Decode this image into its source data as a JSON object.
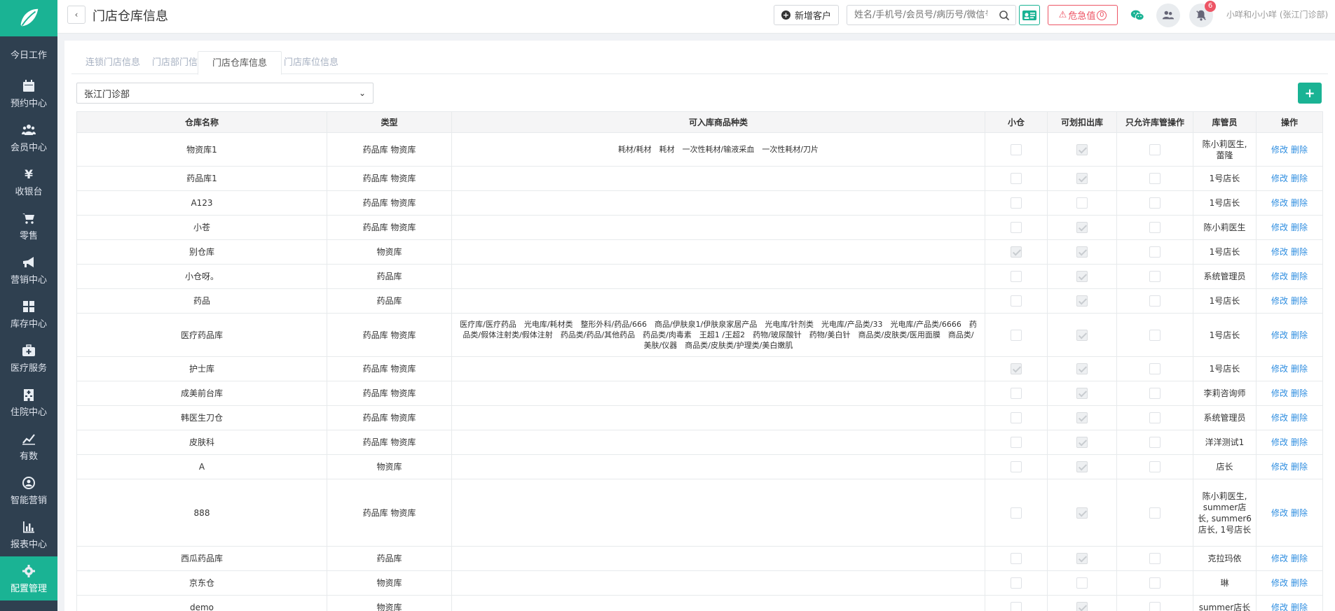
{
  "sidebar": {
    "items": [
      {
        "label": "今日工作",
        "icon": "none"
      },
      {
        "label": "预约中心",
        "icon": "calendar-icon"
      },
      {
        "label": "会员中心",
        "icon": "users-icon"
      },
      {
        "label": "收银台",
        "icon": "yen-icon"
      },
      {
        "label": "零售",
        "icon": "cart-icon"
      },
      {
        "label": "营销中心",
        "icon": "bullhorn-icon"
      },
      {
        "label": "库存中心",
        "icon": "grid-icon"
      },
      {
        "label": "医疗服务",
        "icon": "medkit-icon"
      },
      {
        "label": "住院中心",
        "icon": "hospital-icon"
      },
      {
        "label": "有数",
        "icon": "chart-line-icon"
      },
      {
        "label": "智能营销",
        "icon": "robot-icon"
      },
      {
        "label": "报表中心",
        "icon": "bar-chart-icon"
      },
      {
        "label": "配置管理",
        "icon": "cog-icon"
      }
    ],
    "active_color": "#1ab394",
    "bg_color": "#2f4050"
  },
  "header": {
    "back_label": "‹",
    "title": "门店仓库信息",
    "new_customer": "新增客户",
    "search_placeholder": "姓名/手机号/会员号/病历号/微信号",
    "danger_label": "危急值",
    "danger_count": "0",
    "notice_badge": "6",
    "user": "小咩和小小咩 (张江门诊部)"
  },
  "tabs": [
    "连锁门店信息",
    "门店部门信息",
    "门店仓库信息",
    "门店库位信息"
  ],
  "active_tab": 2,
  "store_select": "张江门诊部",
  "add_label": "+",
  "columns": [
    "仓库名称",
    "类型",
    "可入库商品种类",
    "小仓",
    "可划扣出库",
    "只允许库管操作",
    "库管员",
    "操作"
  ],
  "actions": {
    "edit": "修改",
    "delete": "删除"
  },
  "rows": [
    {
      "name": "物资库1",
      "type": "药品库 物资库",
      "cats": "耗材/耗材　耗材　一次性耗材/输液采血　一次性耗材/刀片",
      "small": false,
      "deduct": true,
      "adminonly": false,
      "keeper": "陈小莉医生, 蕾隆"
    },
    {
      "name": "药品库1",
      "type": "药品库 物资库",
      "cats": "",
      "small": false,
      "deduct": true,
      "adminonly": false,
      "keeper": "1号店长"
    },
    {
      "name": "A123",
      "type": "药品库 物资库",
      "cats": "",
      "small": false,
      "deduct": false,
      "adminonly": false,
      "keeper": "1号店长"
    },
    {
      "name": "小苍",
      "type": "药品库 物资库",
      "cats": "",
      "small": false,
      "deduct": true,
      "adminonly": false,
      "keeper": "陈小莉医生"
    },
    {
      "name": "别仓库",
      "type": "物资库",
      "cats": "",
      "small": true,
      "deduct": true,
      "adminonly": false,
      "keeper": "1号店长"
    },
    {
      "name": "小仓呀。",
      "type": "药品库",
      "cats": "",
      "small": false,
      "deduct": true,
      "adminonly": false,
      "keeper": "系统管理员"
    },
    {
      "name": "药品",
      "type": "药品库",
      "cats": "",
      "small": false,
      "deduct": true,
      "adminonly": false,
      "keeper": "1号店长"
    },
    {
      "name": "医疗药品库",
      "type": "药品库 物资库",
      "cats": "医疗库/医疗药品　光电库/耗材类　整形外科/药品/666　商品/伊肤泉1/伊肤泉家居产品　光电库/针剂类　光电库/产品类/33　光电库/产品类/6666　药品类/假体注射类/假体注射　药品类/药品/其他药品　药品类/肉毒素　王超1 /王超2　药物/玻尿酸针　药物/美白针　商品类/皮肤类/医用面膜　商品类/美肤/仪器　商品类/皮肤类/护理类/美白嫩肌",
      "small": false,
      "deduct": true,
      "adminonly": false,
      "keeper": "1号店长"
    },
    {
      "name": "护士库",
      "type": "药品库 物资库",
      "cats": "",
      "small": true,
      "deduct": true,
      "adminonly": false,
      "keeper": "1号店长"
    },
    {
      "name": "成美前台库",
      "type": "药品库 物资库",
      "cats": "",
      "small": false,
      "deduct": true,
      "adminonly": false,
      "keeper": "李莉咨询师"
    },
    {
      "name": "韩医生刀仓",
      "type": "药品库 物资库",
      "cats": "",
      "small": false,
      "deduct": true,
      "adminonly": false,
      "keeper": "系统管理员"
    },
    {
      "name": "皮肤科",
      "type": "药品库 物资库",
      "cats": "",
      "small": false,
      "deduct": true,
      "adminonly": false,
      "keeper": "洋洋测试1"
    },
    {
      "name": "A",
      "type": "物资库",
      "cats": "",
      "small": false,
      "deduct": true,
      "adminonly": false,
      "keeper": "店长"
    },
    {
      "name": "888",
      "type": "药品库 物资库",
      "cats": "",
      "small": false,
      "deduct": true,
      "adminonly": false,
      "keeper": "陈小莉医生, summer店长, summer6店长, 1号店长"
    },
    {
      "name": "西瓜药品库",
      "type": "药品库",
      "cats": "",
      "small": false,
      "deduct": true,
      "adminonly": false,
      "keeper": "克拉玛依"
    },
    {
      "name": "京东仓",
      "type": "物资库",
      "cats": "",
      "small": false,
      "deduct": false,
      "adminonly": false,
      "keeper": "琳"
    },
    {
      "name": "demo",
      "type": "物资库",
      "cats": "",
      "small": false,
      "deduct": true,
      "adminonly": false,
      "keeper": "summer店长"
    }
  ]
}
